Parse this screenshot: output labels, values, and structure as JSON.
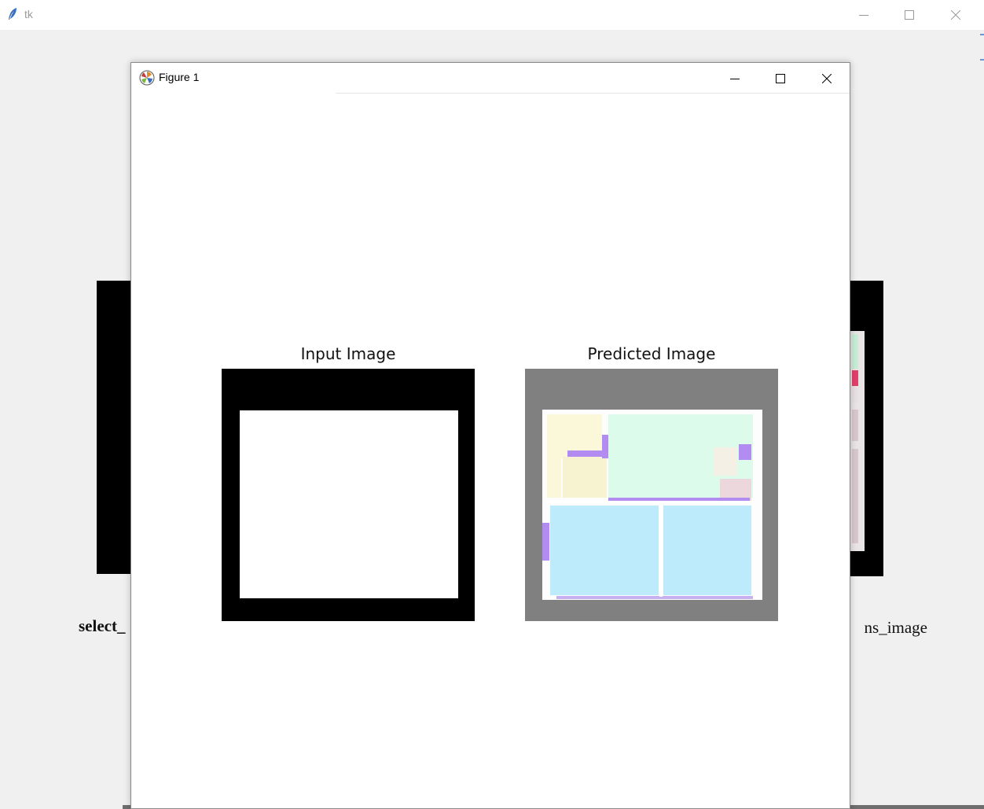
{
  "tk_window": {
    "title": "tk",
    "left_label": "select_",
    "right_label": "ns_image"
  },
  "figure_window": {
    "title": "Figure 1",
    "subplots": [
      {
        "title": "Input Image"
      },
      {
        "title": "Predicted Image"
      }
    ]
  },
  "colors": {
    "input_border": "#000000",
    "input_fill": "#ffffff",
    "predicted_background": "#808080",
    "room_green": "#dcfbea",
    "room_blue": "#bdebfb",
    "room_yellow": "#fbf8d9",
    "room_purple": "#b28cf0",
    "room_pink": "#ecd8dc"
  },
  "icons": {
    "tk": "feather-icon",
    "figure": "matplotlib-icon",
    "minimize": "minimize-icon",
    "maximize": "maximize-icon",
    "close": "close-icon"
  }
}
